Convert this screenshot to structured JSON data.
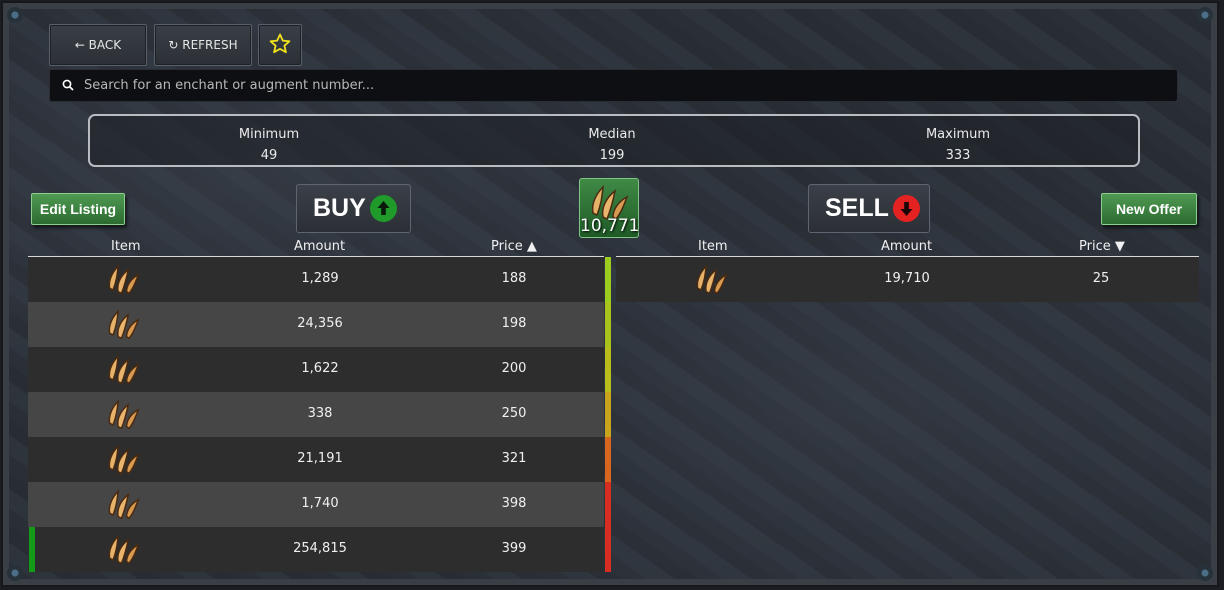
{
  "toolbar": {
    "back_label": "← BACK",
    "refresh_label": "↻ REFRESH"
  },
  "search": {
    "placeholder": "Search for an enchant or augment number..."
  },
  "stats": {
    "minimum_label": "Minimum",
    "minimum_value": "49",
    "median_label": "Median",
    "median_value": "199",
    "maximum_label": "Maximum",
    "maximum_value": "333"
  },
  "actions": {
    "edit_listing_label": "Edit Listing",
    "new_offer_label": "New Offer",
    "buy_label": "BUY",
    "sell_label": "SELL"
  },
  "selected_item": {
    "icon": "claw-fang-icon",
    "count": "10,771"
  },
  "buy_table": {
    "headers": {
      "item": "Item",
      "amount": "Amount",
      "price": "Price ▲"
    },
    "rows": [
      {
        "amount": "1,289",
        "price": "188",
        "indicator_color": "#9ccc1e"
      },
      {
        "amount": "24,356",
        "price": "198",
        "indicator_color": "#a8c41c"
      },
      {
        "amount": "1,622",
        "price": "200",
        "indicator_color": "#b8bd1c"
      },
      {
        "amount": "338",
        "price": "250",
        "indicator_color": "#c9a51d"
      },
      {
        "amount": "21,191",
        "price": "321",
        "indicator_color": "#d9661e"
      },
      {
        "amount": "1,740",
        "price": "398",
        "indicator_color": "#d82e22"
      },
      {
        "amount": "254,815",
        "price": "399",
        "indicator_color": "#d82e22"
      }
    ]
  },
  "sell_table": {
    "headers": {
      "item": "Item",
      "amount": "Amount",
      "price": "Price ▼"
    },
    "rows": [
      {
        "amount": "19,710",
        "price": "25"
      }
    ]
  },
  "colors": {
    "buy_icon": "#1f9a2b",
    "sell_icon": "#e52222",
    "green_button": "#3c8a41",
    "owned_marker": "#139a19"
  }
}
